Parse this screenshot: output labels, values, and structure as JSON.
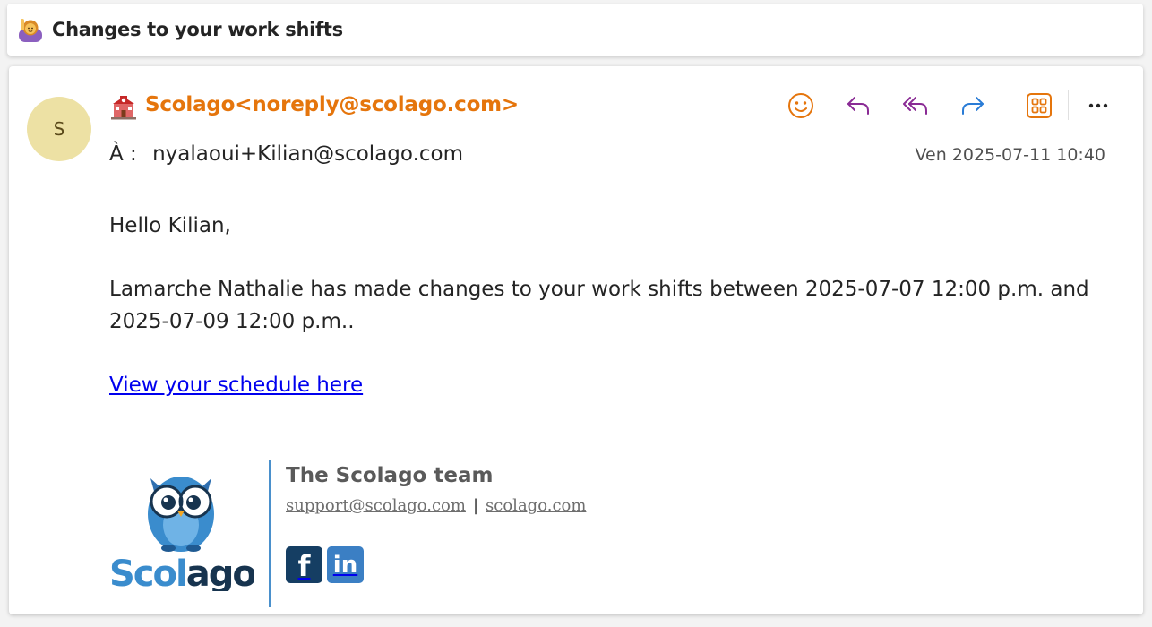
{
  "subject": {
    "emoji_icon": "person-raising-hand-icon",
    "title": "Changes to your work shifts"
  },
  "message": {
    "avatar_initial": "S",
    "sender_icon": "school-building-icon",
    "sender": "Scolago<noreply@scolago.com>",
    "to_label": "À :",
    "to_address": "nyalaoui+Kilian@scolago.com",
    "date": "Ven 2025-07-11 10:40"
  },
  "toolbar": {
    "icons": [
      "smiley-icon",
      "reply-icon",
      "reply-all-icon",
      "forward-icon",
      "apps-icon",
      "more-icon"
    ]
  },
  "body": {
    "greeting": "Hello Kilian,",
    "paragraph": "Lamarche Nathalie has made changes to your work shifts between 2025-07-07 12:00 p.m. and 2025-07-09 12:00 p.m..",
    "link": "View your schedule here"
  },
  "signature": {
    "logo_text": "Scolago",
    "team_name": "The Scolago team",
    "support_email": "support@scolago.com",
    "separator": "|",
    "website": "scolago.com",
    "facebook_label": "f",
    "linkedin_label": "in"
  },
  "colors": {
    "sender": "#e5750c",
    "avatar_bg": "#ede1a4",
    "reply_purple": "#8a2b95",
    "forward_blue": "#2a7cd6",
    "link": "#0000ee",
    "facebook": "#153e63",
    "linkedin": "#3b7fc4",
    "scolago_blue": "#3a8ccd",
    "scolago_dark": "#17344f"
  }
}
